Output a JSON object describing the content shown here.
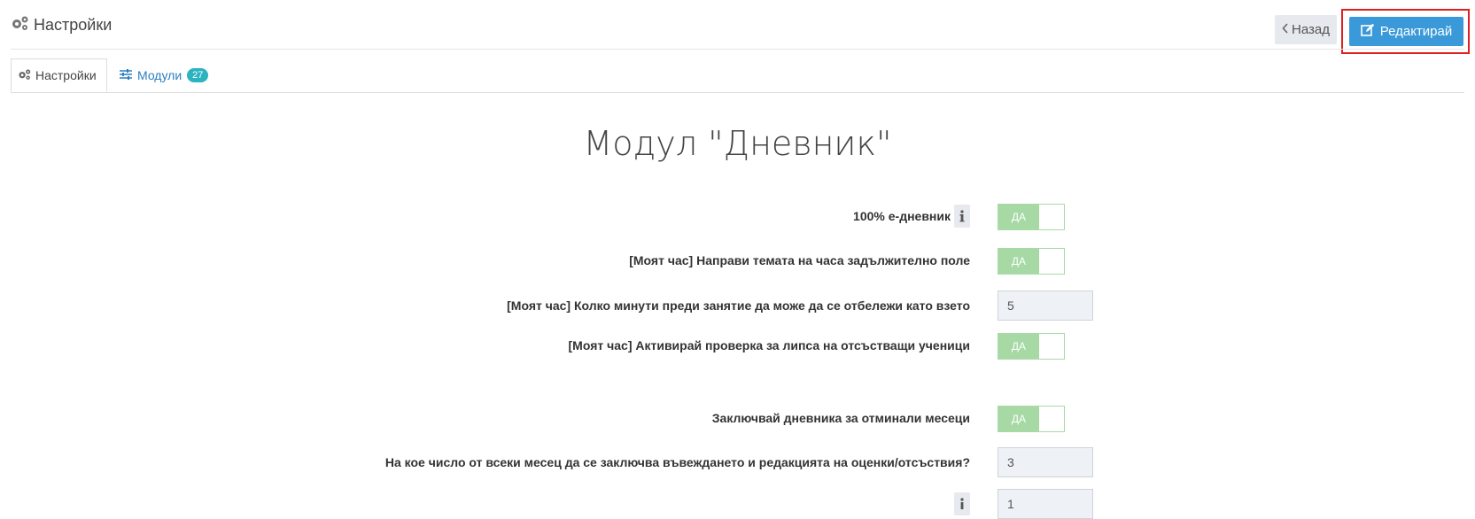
{
  "header": {
    "title": "Настройки",
    "back_label": "Назад",
    "edit_label": "Редактирай"
  },
  "tabs": [
    {
      "label": "Настройки",
      "active": true
    },
    {
      "label": "Модули",
      "badge": "27",
      "active": false
    }
  ],
  "page_title": "Модул \"Дневник\"",
  "settings": [
    {
      "label": "100% е-дневник",
      "type": "toggle",
      "value": "ДА",
      "info": true
    },
    {
      "label": "[Моят час] Направи темата на часа задължително поле",
      "type": "toggle",
      "value": "ДА"
    },
    {
      "label": "[Моят час] Колко минути преди занятие да може да се отбележи като взето",
      "type": "number",
      "value": "5"
    },
    {
      "label": "[Моят час] Активирай проверка за липса на отсъстващи ученици",
      "type": "toggle",
      "value": "ДА"
    },
    {
      "label": "Заключвай дневника за отминали месеци",
      "type": "toggle",
      "value": "ДА"
    },
    {
      "label": "На кое число от всеки месец да се заключва въвеждането и редакцията на оценки/отсъствия?",
      "type": "number",
      "value": "3"
    },
    {
      "label": "",
      "type": "number",
      "value": "1",
      "info": true
    }
  ],
  "colors": {
    "primary": "#3a9ad9",
    "toggle_on": "#a7d9a4",
    "highlight": "#e01f1f",
    "badge": "#2bb3c0"
  }
}
